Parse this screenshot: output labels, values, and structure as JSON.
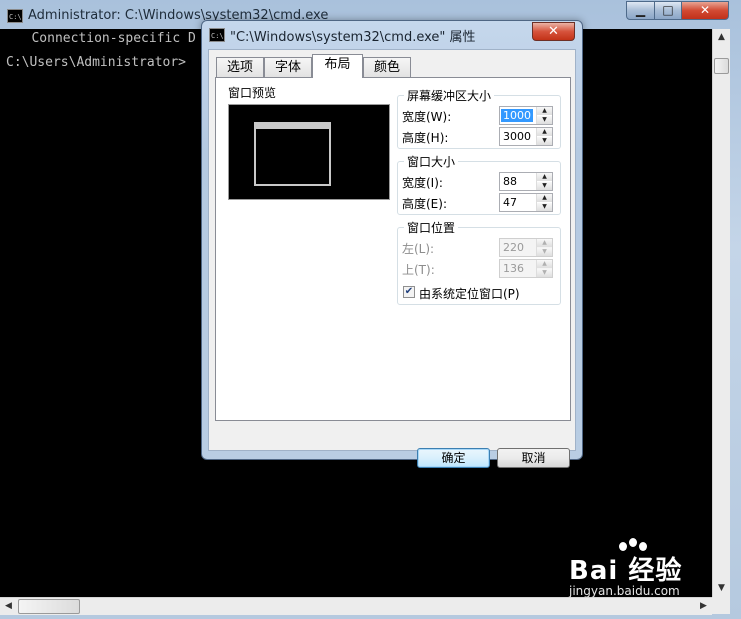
{
  "console_window": {
    "title": "Administrator: C:\\Windows\\system32\\cmd.exe",
    "icon": "cmd-icon",
    "lines": [
      "   Connection-specific D",
      "C:\\Users\\Administrator>"
    ],
    "controls": {
      "minimize": "▁",
      "maximize": "□",
      "close": "✕"
    }
  },
  "dialog": {
    "title": "\"C:\\Windows\\system32\\cmd.exe\" 属性",
    "close": "✕",
    "tabs": [
      {
        "label": "选项",
        "active": false
      },
      {
        "label": "字体",
        "active": false
      },
      {
        "label": "布局",
        "active": true
      },
      {
        "label": "颜色",
        "active": false
      }
    ],
    "preview_label": "窗口预览",
    "buffer_size": {
      "title": "屏幕缓冲区大小",
      "width_label": "宽度(W):",
      "width_value": "1000",
      "height_label": "高度(H):",
      "height_value": "3000"
    },
    "window_size": {
      "title": "窗口大小",
      "width_label": "宽度(I):",
      "width_value": "88",
      "height_label": "高度(E):",
      "height_value": "47"
    },
    "window_position": {
      "title": "窗口位置",
      "left_label": "左(L):",
      "left_value": "220",
      "top_label": "上(T):",
      "top_value": "136",
      "system_position_label": "由系统定位窗口(P)",
      "system_position_checked": true
    },
    "ok_button": "确定",
    "cancel_button": "取消"
  },
  "watermark": {
    "text": "Bai  经验",
    "url": "jingyan.baidu.com"
  }
}
